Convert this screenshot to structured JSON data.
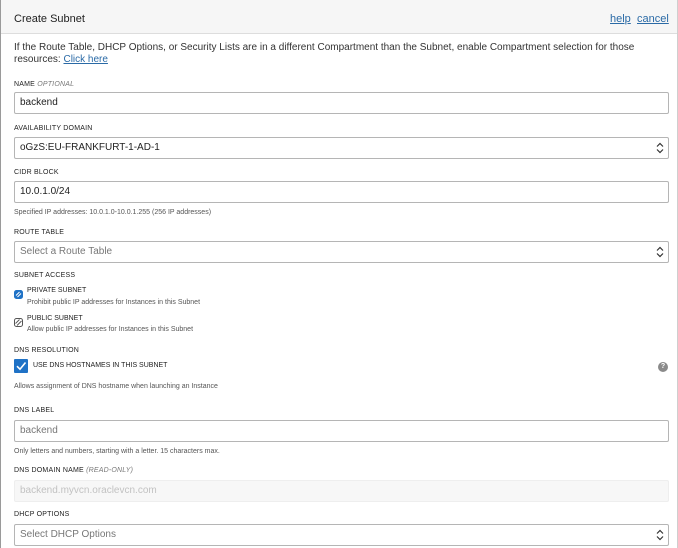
{
  "header": {
    "title": "Create Subnet",
    "help_label": "help",
    "cancel_label": "cancel"
  },
  "intro": {
    "text": "If the Route Table, DHCP Options, or Security Lists are in a different Compartment than the Subnet, enable Compartment selection for those resources: ",
    "link_label": "Click here"
  },
  "name": {
    "label": "NAME",
    "optional": "OPTIONAL",
    "value": "backend"
  },
  "availability_domain": {
    "label": "AVAILABILITY DOMAIN",
    "value": "oGzS:EU-FRANKFURT-1-AD-1"
  },
  "cidr_block": {
    "label": "CIDR BLOCK",
    "value": "10.0.1.0/24",
    "hint": "Specified IP addresses: 10.0.1.0-10.0.1.255 (256 IP addresses)"
  },
  "route_table": {
    "label": "ROUTE TABLE",
    "placeholder": "Select a Route Table"
  },
  "subnet_access": {
    "label": "SUBNET ACCESS",
    "options": [
      {
        "label": "PRIVATE SUBNET",
        "description": "Prohibit public IP addresses for Instances in this Subnet",
        "selected": true
      },
      {
        "label": "PUBLIC SUBNET",
        "description": "Allow public IP addresses for Instances in this Subnet",
        "selected": false
      }
    ]
  },
  "dns_resolution": {
    "label": "DNS RESOLUTION",
    "checkbox_label": "USE DNS HOSTNAMES IN THIS SUBNET",
    "checked": true,
    "hint": "Allows assignment of DNS hostname when launching an Instance",
    "help_icon": "question-icon",
    "help_glyph": "?"
  },
  "dns_label": {
    "label": "DNS LABEL",
    "value": "backend",
    "hint": "Only letters and numbers, starting with a letter. 15 characters max."
  },
  "dns_domain_name": {
    "label": "DNS DOMAIN NAME",
    "readonly_tag": "(READ-ONLY)",
    "value": "backend.myvcn.oraclevcn.com"
  },
  "dhcp_options": {
    "label": "DHCP OPTIONS",
    "placeholder": "Select DHCP Options"
  },
  "colors": {
    "link": "#2a6aa6",
    "checkbox": "#1f72c6",
    "header_bg": "#f6f6f6"
  }
}
